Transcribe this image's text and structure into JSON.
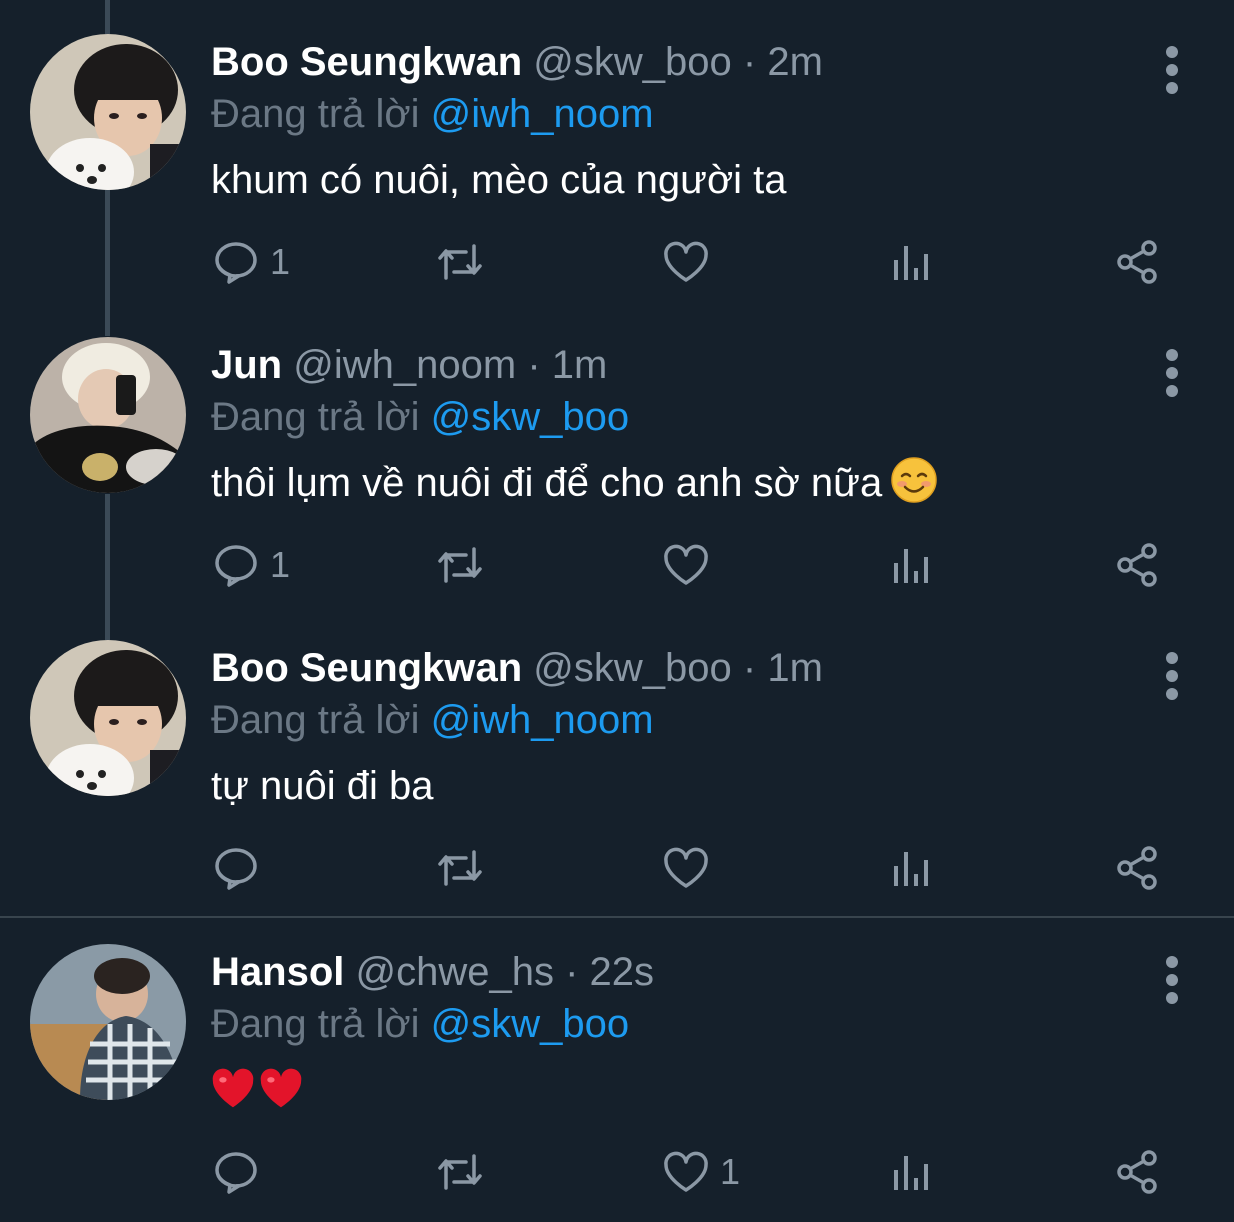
{
  "reply_prefix": "Đang trả lời",
  "tweets": [
    {
      "name": "Boo Seungkwan",
      "handle": "@skw_boo",
      "separator": "·",
      "time": "2m",
      "reply_to": "@iwh_noom",
      "text": "khum có nuôi, mèo của người ta",
      "reply_count": "1",
      "like_count": ""
    },
    {
      "name": "Jun",
      "handle": "@iwh_noom",
      "separator": "·",
      "time": "1m",
      "reply_to": "@skw_boo",
      "text": "thôi lụm về nuôi đi để cho anh sờ nữa",
      "emoji": "smiling-face-emoji",
      "reply_count": "1",
      "like_count": ""
    },
    {
      "name": "Boo Seungkwan",
      "handle": "@skw_boo",
      "separator": "·",
      "time": "1m",
      "reply_to": "@iwh_noom",
      "text": "tự nuôi đi ba",
      "reply_count": "",
      "like_count": ""
    },
    {
      "name": "Hansol",
      "handle": "@chwe_hs",
      "separator": "·",
      "time": "22s",
      "reply_to": "@skw_boo",
      "text": "",
      "emoji": "red-heart-emoji x2",
      "reply_count": "",
      "like_count": "1"
    }
  ],
  "colors": {
    "background": "#15202b",
    "text": "#ffffff",
    "secondary": "#8b98a5",
    "mention": "#1d9bf0",
    "thread_line": "#3b4a57"
  },
  "icons": [
    "reply-icon",
    "retweet-icon",
    "like-icon",
    "views-icon",
    "share-icon",
    "more-icon"
  ]
}
